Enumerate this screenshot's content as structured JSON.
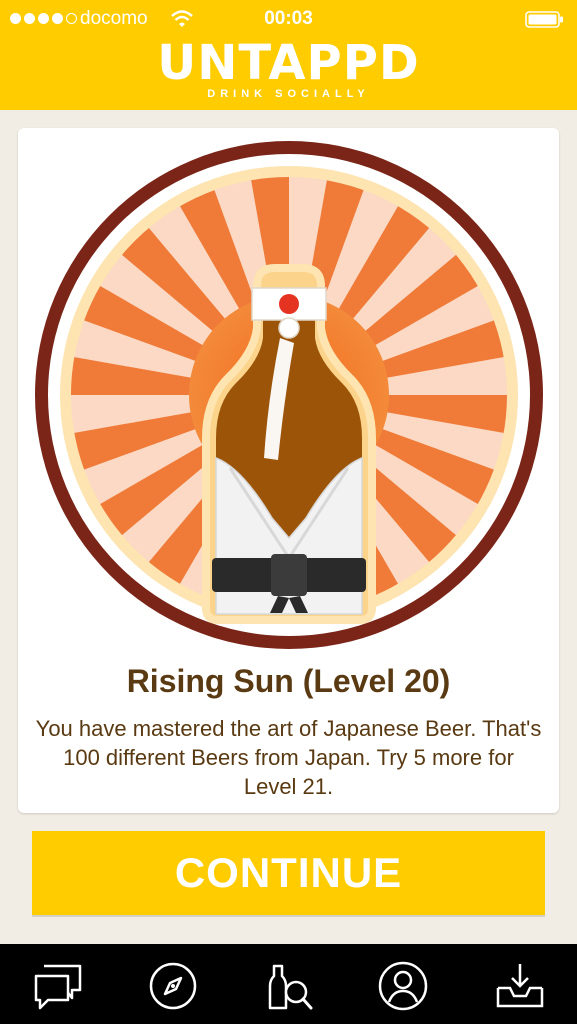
{
  "status_bar": {
    "carrier": "docomo",
    "time": "00:03",
    "signal_dots_filled": 4,
    "signal_dots_total": 5
  },
  "brand": {
    "name": "UNTAPPD",
    "tagline": "DRINK SOCIALLY"
  },
  "badge": {
    "title": "Rising Sun (Level 20)",
    "description": "You have mastered the art of Japanese Beer. That's 100 different Beers from Japan. Try 5 more for Level 21."
  },
  "actions": {
    "continue_label": "CONTINUE"
  },
  "tabs": [
    {
      "name": "activity-feed",
      "icon": "chat-bubbles-icon"
    },
    {
      "name": "explore",
      "icon": "compass-icon"
    },
    {
      "name": "search-beer",
      "icon": "beer-search-icon"
    },
    {
      "name": "profile",
      "icon": "user-icon"
    },
    {
      "name": "inbox",
      "icon": "download-tray-icon"
    }
  ],
  "colors": {
    "brand_yellow": "#ffcc00",
    "text_brown": "#5a3a12",
    "badge_ring": "#7b2518",
    "sunburst": "#f07a37",
    "background": "#f1ece4"
  }
}
